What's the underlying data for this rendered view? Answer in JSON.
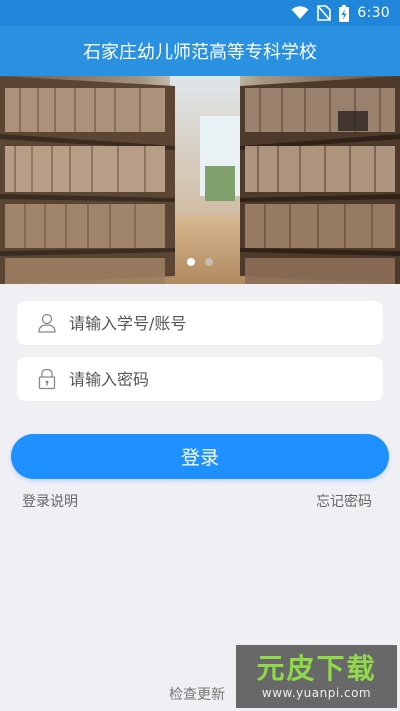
{
  "status_bar": {
    "time": "6:30",
    "icons": [
      "wifi-icon",
      "no-sim-icon",
      "battery-icon"
    ]
  },
  "header": {
    "title": "石家庄幼儿师范高等专科学校"
  },
  "banner": {
    "slides": 2,
    "active_slide": 1,
    "image": "library-bookshelves"
  },
  "form": {
    "account_placeholder": "请输入学号/账号",
    "account_value": "",
    "password_placeholder": "请输入密码",
    "password_value": "",
    "login_label": "登录",
    "help_label": "登录说明",
    "forgot_label": "忘记密码"
  },
  "footer": {
    "check_update_label": "检查更新"
  },
  "watermark": {
    "title": "元皮下载",
    "url": "www.yuanpi.com"
  },
  "colors": {
    "primary": "#1e90ff",
    "header": "#2a90e0",
    "status_bar": "#1f86d9",
    "background": "#f0eff4"
  }
}
